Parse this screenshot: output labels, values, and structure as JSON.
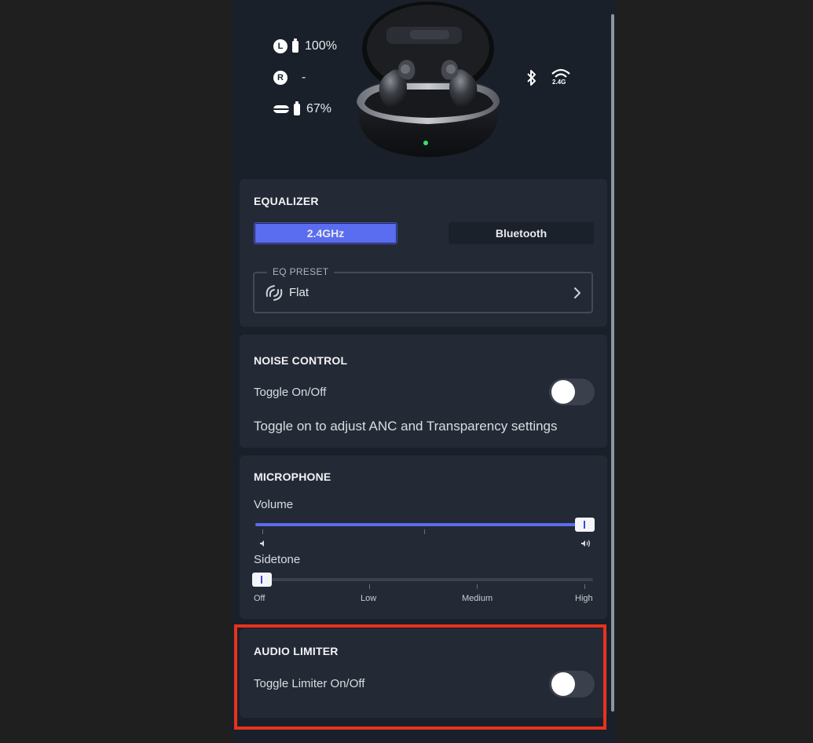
{
  "status": {
    "left": {
      "badge": "L",
      "level": "100%"
    },
    "right": {
      "badge": "R",
      "level": "-"
    },
    "case": {
      "level": "67%"
    }
  },
  "connection_icons": [
    "bluetooth-icon",
    "wireless-2-4g-icon"
  ],
  "wireless_label": "2.4G",
  "equalizer": {
    "title": "EQUALIZER",
    "tabs": [
      {
        "label": "2.4GHz",
        "active": true
      },
      {
        "label": "Bluetooth",
        "active": false
      }
    ],
    "preset_legend": "EQ PRESET",
    "preset_value": "Flat"
  },
  "noise_control": {
    "title": "NOISE CONTROL",
    "toggle_label": "Toggle On/Off",
    "toggle_on": false,
    "hint": "Toggle on to adjust ANC and Transparency settings"
  },
  "microphone": {
    "title": "MICROPHONE",
    "volume_label": "Volume",
    "volume_level": 1.0,
    "sidetone_label": "Sidetone",
    "sidetone_level": 0,
    "sidetone_options": [
      "Off",
      "Low",
      "Medium",
      "High"
    ]
  },
  "audio_limiter": {
    "title": "AUDIO LIMITER",
    "toggle_label": "Toggle Limiter On/Off",
    "toggle_on": false
  },
  "colors": {
    "accent": "#5a6cf0",
    "highlight": "#e8321f",
    "card": "#242a35",
    "background": "#1a2029"
  }
}
